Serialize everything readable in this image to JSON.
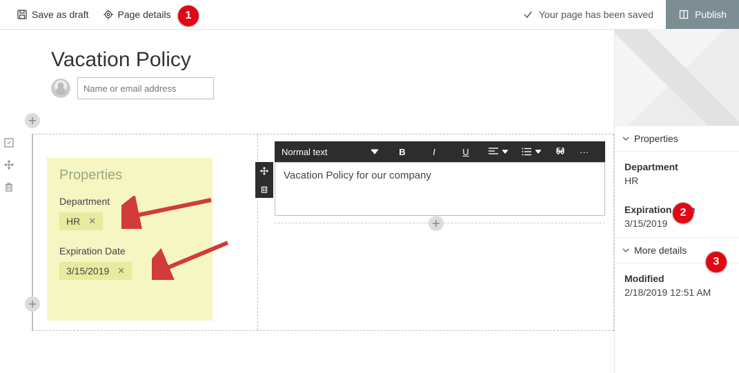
{
  "topbar": {
    "save_draft_label": "Save as draft",
    "page_details_label": "Page details",
    "saved_message": "Your page has been saved",
    "publish_label": "Publish"
  },
  "callouts": {
    "c1": "1",
    "c2": "2",
    "c3": "3"
  },
  "page": {
    "title": "Vacation Policy",
    "people_placeholder": "Name or email address"
  },
  "properties_card": {
    "title": "Properties",
    "department_label": "Department",
    "department_value": "HR",
    "expiration_label": "Expiration Date",
    "expiration_value": "3/15/2019"
  },
  "text_webpart": {
    "style_dropdown": "Normal text",
    "bold": "B",
    "italic": "I",
    "underline": "U",
    "more": "···",
    "body": "Vacation Policy for our company"
  },
  "side": {
    "properties_header": "Properties",
    "department_label": "Department",
    "department_value": "HR",
    "expiration_label": "Expiration Date",
    "expiration_value": "3/15/2019",
    "more_details_header": "More details",
    "modified_label": "Modified",
    "modified_value": "2/18/2019 12:51 AM"
  }
}
